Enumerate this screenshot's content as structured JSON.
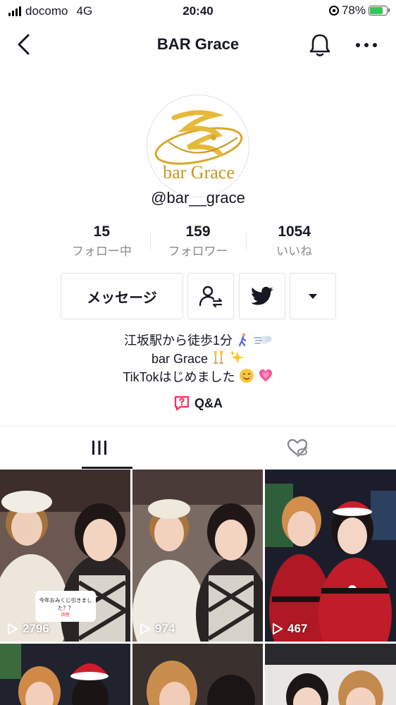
{
  "status_bar": {
    "carrier": "docomo",
    "network": "4G",
    "time": "20:40",
    "battery": "78%",
    "battery_level": 0.78
  },
  "nav": {
    "title": "BAR Grace",
    "back_icon": "chevron-left-icon",
    "bell_icon": "bell-icon",
    "more_icon": "more-icon"
  },
  "profile": {
    "avatar_text": "bar Grace",
    "username": "@bar__grace"
  },
  "stats": [
    {
      "value": "15",
      "label": "フォロー中"
    },
    {
      "value": "159",
      "label": "フォロワー"
    },
    {
      "value": "1054",
      "label": "いいね"
    }
  ],
  "actions": {
    "message_label": "メッセージ"
  },
  "bio": {
    "line1": "江坂駅から徒歩1分",
    "line2": "bar Grace",
    "line3": "TikTokはじめました",
    "qa_label": "Q&A"
  },
  "colors": {
    "accent_pink": "#fe2c55",
    "gold": "#d9a82c",
    "text": "#161823",
    "muted": "#8a8b91"
  },
  "videos": [
    {
      "views": "2796",
      "sticker_text": "今年おみくじ引きました？？",
      "sticker_tag": "回答"
    },
    {
      "views": "974"
    },
    {
      "views": "467"
    },
    {
      "views": ""
    },
    {
      "views": ""
    },
    {
      "views": ""
    }
  ]
}
